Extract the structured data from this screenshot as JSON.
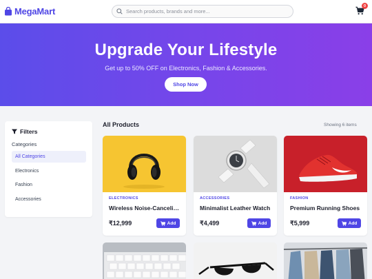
{
  "header": {
    "logo_text": "MegaMart",
    "search_placeholder": "Search products, brands and more...",
    "cart_count": "0"
  },
  "hero": {
    "title": "Upgrade Your Lifestyle",
    "subtitle": "Get up to 50% OFF on Electronics, Fashion & Accessories.",
    "button_label": "Shop Now"
  },
  "sidebar": {
    "title": "Filters",
    "categories_label": "Categories",
    "items": [
      {
        "label": "All Categories",
        "active": true
      },
      {
        "label": "Electronics",
        "active": false
      },
      {
        "label": "Fashion",
        "active": false
      },
      {
        "label": "Accessories",
        "active": false
      }
    ]
  },
  "products": {
    "title": "All Products",
    "count_text": "Showing 6 items",
    "add_label": "Add",
    "items": [
      {
        "category": "ELECTRONICS",
        "name": "Wireless Noise-Canceling Headphones",
        "price": "₹12,999",
        "image": "headphones",
        "bg": "#f6c531"
      },
      {
        "category": "ACCESSORIES",
        "name": "Minimalist Leather Watch",
        "price": "₹4,499",
        "image": "watch",
        "bg": "#dcdcdc"
      },
      {
        "category": "FASHION",
        "name": "Premium Running Shoes",
        "price": "₹5,999",
        "image": "shoe",
        "bg": "#c8202a"
      },
      {
        "image": "keyboard",
        "bg": "#b9bdc3"
      },
      {
        "image": "sunglasses",
        "bg": "#f2f2f2"
      },
      {
        "image": "clothes-rack",
        "bg": "#d9dce1"
      }
    ]
  },
  "icons": {
    "logo": "shopping-bag-icon",
    "search": "search-icon",
    "cart": "cart-icon",
    "filter": "filter-icon",
    "add": "cart-plus-icon"
  },
  "colors": {
    "accent": "#4f46e5",
    "hero_start": "#5b4dea",
    "hero_end": "#8a3fe8",
    "badge": "#ef4444"
  }
}
